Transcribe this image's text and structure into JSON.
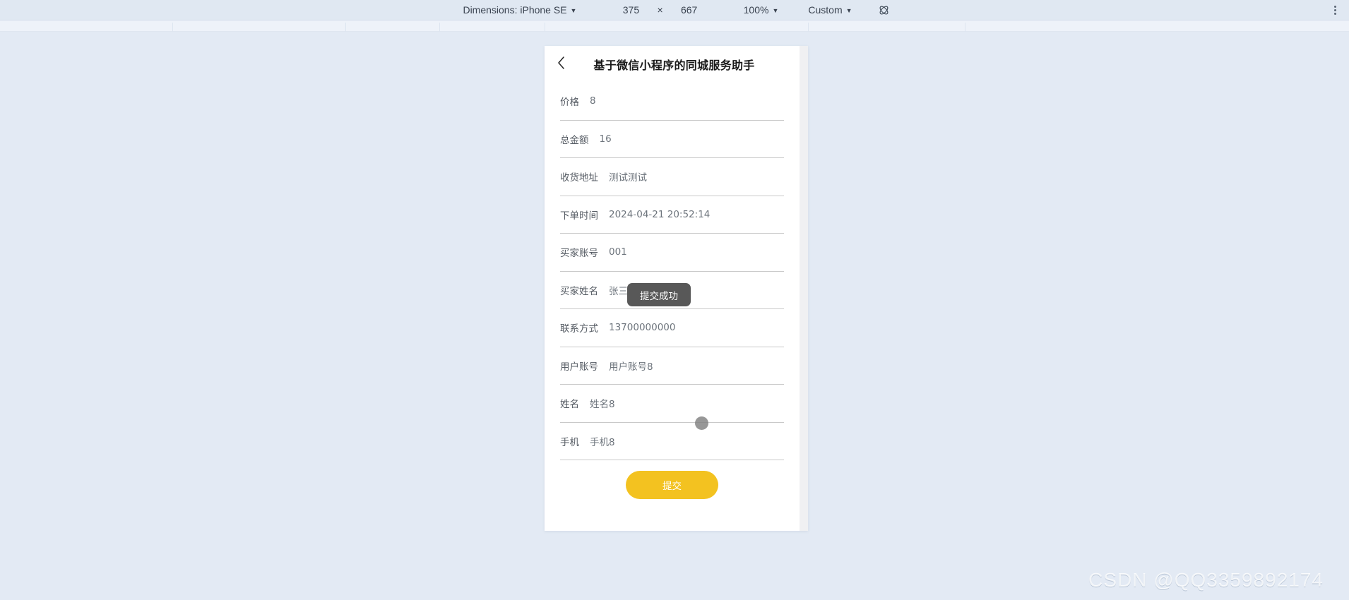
{
  "device_toolbar": {
    "dimensions_label": "Dimensions: iPhone SE",
    "width_value": "375",
    "multiply_symbol": "×",
    "height_value": "667",
    "zoom_label": "100%",
    "preset_label": "Custom",
    "rotate_icon_name": "rotate-device-icon",
    "overflow_icon_name": "more-options-icon",
    "caret": "▼"
  },
  "app": {
    "nav_title": "基于微信小程序的同城服务助手",
    "back_icon_name": "chevron-left-icon"
  },
  "form": {
    "rows": [
      {
        "label": "价格",
        "value": "8"
      },
      {
        "label": "总金额",
        "value": "16"
      },
      {
        "label": "收货地址",
        "value": "测试测试"
      },
      {
        "label": "下单时间",
        "value": "2024-04-21 20:52:14"
      },
      {
        "label": "买家账号",
        "value": "001"
      },
      {
        "label": "买家姓名",
        "value": "张三"
      },
      {
        "label": "联系方式",
        "value": "13700000000"
      },
      {
        "label": "用户账号",
        "value": "用户账号8"
      },
      {
        "label": "姓名",
        "value": "姓名8"
      },
      {
        "label": "手机",
        "value": "手机8"
      }
    ],
    "submit_label": "提交",
    "submit_color": "#f3c220"
  },
  "toast": {
    "message": "提交成功",
    "background": "#585858"
  },
  "watermark": {
    "text": "CSDN @QQ3359892174"
  }
}
